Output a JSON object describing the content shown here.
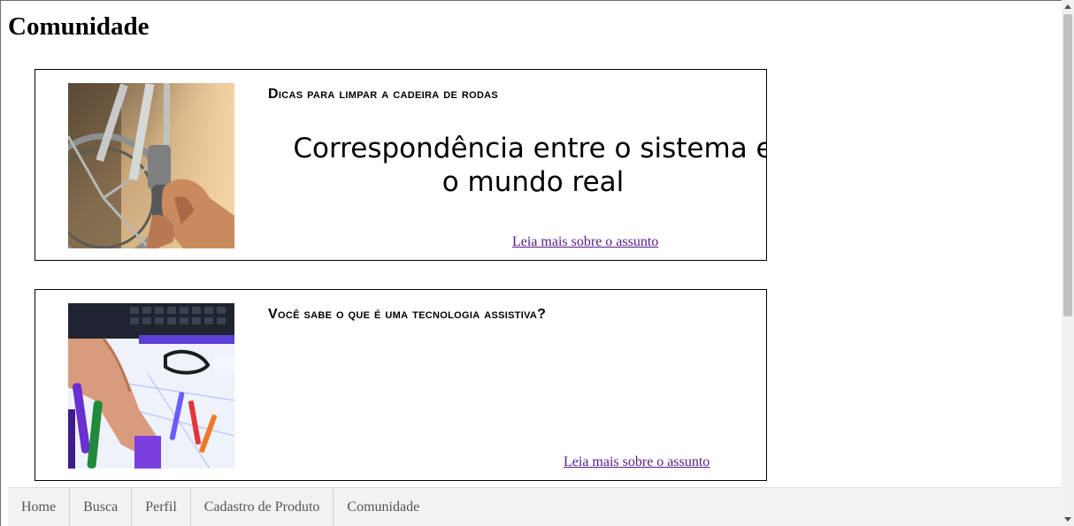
{
  "page": {
    "title": "Comunidade"
  },
  "cards": [
    {
      "heading": "Dicas para limpar a cadeira de rodas",
      "body": "Correspondência entre o sistema e o mundo real",
      "link": "Leia mais sobre o assunto",
      "image": "wheelchair-cleaning-photo"
    },
    {
      "heading": "Você sabe o que é uma tecnologia assistiva?",
      "body": "",
      "link": "Leia mais sobre o assunto",
      "image": "assistive-technology-photo"
    }
  ],
  "nav": {
    "items": [
      {
        "label": "Home"
      },
      {
        "label": "Busca"
      },
      {
        "label": "Perfil"
      },
      {
        "label": "Cadastro de Produto"
      },
      {
        "label": "Comunidade"
      }
    ]
  },
  "colors": {
    "link_visited": "#551a8b",
    "nav_background": "#f2f2f2",
    "nav_text": "#555555"
  }
}
